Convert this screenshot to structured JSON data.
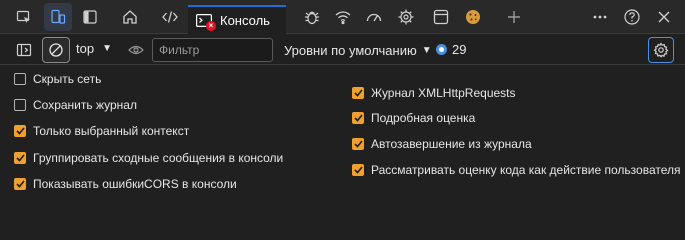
{
  "tabs": {
    "console_label": "Консоль"
  },
  "toolbar": {
    "context_value": "top",
    "filter_placeholder": "Фильтр",
    "levels_label": "Уровни по умолчанию",
    "issues_count": "29"
  },
  "settings": {
    "left": [
      {
        "label": "Скрыть сеть",
        "checked": false
      },
      {
        "label": "Сохранить журнал",
        "checked": false
      },
      {
        "label": "Только выбранный контекст",
        "checked": true
      },
      {
        "label": "Группировать сходные сообщения в консоли",
        "checked": true
      },
      {
        "label": "Показывать ошибкиCORS в консоли",
        "checked": true
      }
    ],
    "right": [
      {
        "label": "Журнал XMLHttpRequests",
        "checked": true
      },
      {
        "label": "Подробная оценка",
        "checked": true
      },
      {
        "label": "Автозавершение из журнала",
        "checked": true
      },
      {
        "label": "Рассматривать оценку кода как действие пользователя",
        "checked": true
      }
    ]
  },
  "colors": {
    "accent": "#f0a030",
    "focus_blue": "#4a90e2",
    "error_red": "#e81123"
  }
}
